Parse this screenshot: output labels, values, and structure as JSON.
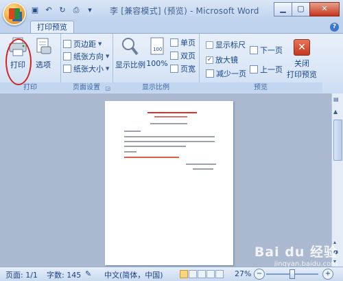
{
  "window": {
    "title": "李 [兼容模式] (预览) - Microsoft Word",
    "minimize": "▁",
    "maximize": "▢",
    "close": "✕"
  },
  "ribbon": {
    "active_tab": "打印预览",
    "help": "?",
    "groups": {
      "print": {
        "label": "打印",
        "print_button": "打印",
        "options_button": "选项"
      },
      "page_setup": {
        "label": "页面设置",
        "margins": "页边距",
        "orientation": "纸张方向",
        "size": "纸张大小"
      },
      "zoom": {
        "label": "显示比例",
        "zoom_button": "显示比例",
        "zoom100": "100%",
        "one_page": "单页",
        "two_pages": "双页",
        "page_width": "页宽"
      },
      "preview": {
        "label": "预览",
        "show_ruler": "显示标尺",
        "magnifier": "放大镜",
        "shrink_one_page": "减少一页",
        "next_page": "下一页",
        "prev_page": "上一页",
        "close_preview_line1": "关闭",
        "close_preview_line2": "打印预览"
      }
    }
  },
  "status": {
    "page": "页面: 1/1",
    "words": "字数: 145",
    "language": "中文(简体，中国)",
    "zoom_percent": "27%",
    "minus": "−",
    "plus": "+"
  },
  "watermark": {
    "line1": "Bai du 经验",
    "line2": "jingyan.baidu.com"
  },
  "colors": {
    "ribbon_bg": "#dbe7f7",
    "workspace_bg": "#aab9cf",
    "highlight_circle": "#d61f1f",
    "close_red": "#c4381e"
  }
}
